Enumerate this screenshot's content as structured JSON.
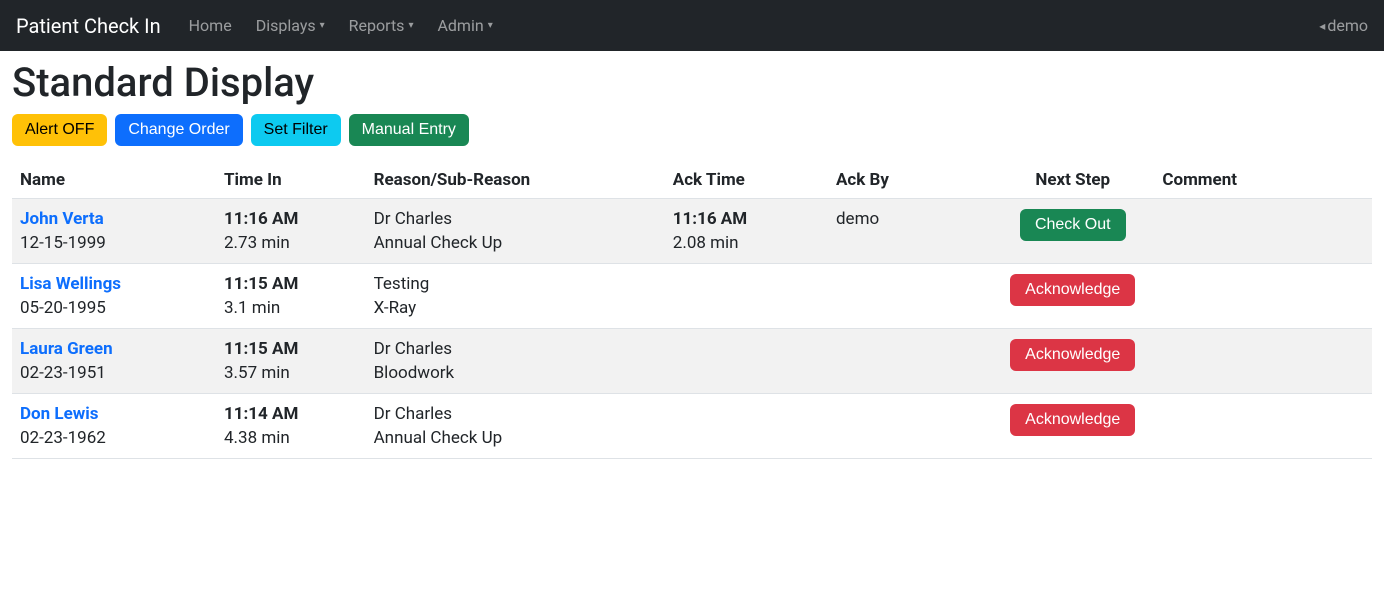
{
  "nav": {
    "brand": "Patient Check In",
    "items": [
      {
        "label": "Home",
        "dropdown": false
      },
      {
        "label": "Displays",
        "dropdown": true
      },
      {
        "label": "Reports",
        "dropdown": true
      },
      {
        "label": "Admin",
        "dropdown": true
      }
    ],
    "user": "demo"
  },
  "page": {
    "title": "Standard Display"
  },
  "buttons": {
    "alert_off": "Alert OFF",
    "change_order": "Change Order",
    "set_filter": "Set Filter",
    "manual_entry": "Manual Entry"
  },
  "table": {
    "headers": {
      "name": "Name",
      "time_in": "Time In",
      "reason": "Reason/Sub-Reason",
      "ack_time": "Ack Time",
      "ack_by": "Ack By",
      "next_step": "Next Step",
      "comment": "Comment"
    },
    "rows": [
      {
        "name": "John Verta",
        "dob": "12-15-1999",
        "time_in": "11:16 AM",
        "duration": "2.73 min",
        "reason": "Dr Charles",
        "sub_reason": "Annual Check Up",
        "ack_time": "11:16 AM",
        "ack_duration": "2.08 min",
        "ack_by": "demo",
        "next_step_label": "Check Out",
        "next_step_class": "btn-success",
        "comment": ""
      },
      {
        "name": "Lisa Wellings",
        "dob": "05-20-1995",
        "time_in": "11:15 AM",
        "duration": "3.1 min",
        "reason": "Testing",
        "sub_reason": "X-Ray",
        "ack_time": "",
        "ack_duration": "",
        "ack_by": "",
        "next_step_label": "Acknowledge",
        "next_step_class": "btn-danger",
        "comment": ""
      },
      {
        "name": "Laura Green",
        "dob": "02-23-1951",
        "time_in": "11:15 AM",
        "duration": "3.57 min",
        "reason": "Dr Charles",
        "sub_reason": "Bloodwork",
        "ack_time": "",
        "ack_duration": "",
        "ack_by": "",
        "next_step_label": "Acknowledge",
        "next_step_class": "btn-danger",
        "comment": ""
      },
      {
        "name": "Don Lewis",
        "dob": "02-23-1962",
        "time_in": "11:14 AM",
        "duration": "4.38 min",
        "reason": "Dr Charles",
        "sub_reason": "Annual Check Up",
        "ack_time": "",
        "ack_duration": "",
        "ack_by": "",
        "next_step_label": "Acknowledge",
        "next_step_class": "btn-danger",
        "comment": ""
      }
    ]
  }
}
